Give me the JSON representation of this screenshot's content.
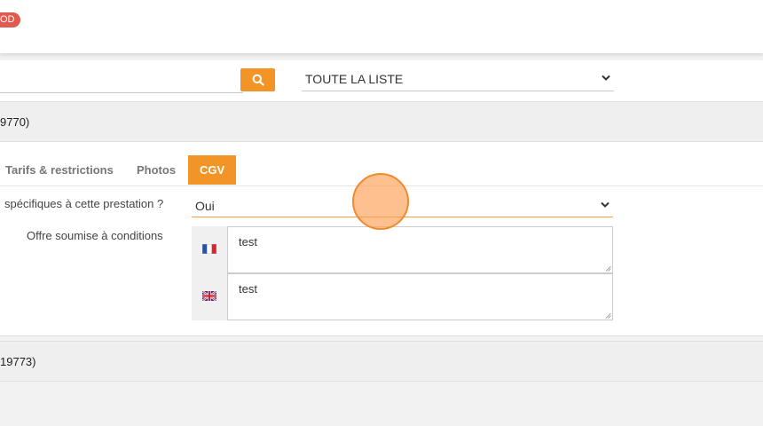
{
  "topbar": {
    "badge_text": "OD"
  },
  "search": {
    "input_value": "",
    "filter_selected": "TOUTE LA LISTE"
  },
  "items": [
    {
      "header": "9770)"
    },
    {
      "header": " 19773)"
    }
  ],
  "tabs": [
    {
      "label": "Tarifs & restrictions",
      "active": false
    },
    {
      "label": "Photos",
      "active": false
    },
    {
      "label": "CGV",
      "active": true
    }
  ],
  "form": {
    "question_label": "spécifiques à cette prestation ?",
    "conditions_select": "Oui",
    "offer_label": "Offre soumise à conditions",
    "languages": [
      {
        "flag": "flag-fr-icon",
        "text": "test"
      },
      {
        "flag": "flag-gb-icon",
        "text": "test"
      }
    ]
  },
  "colors": {
    "accent": "#f39427",
    "badge": "#e05a50"
  }
}
